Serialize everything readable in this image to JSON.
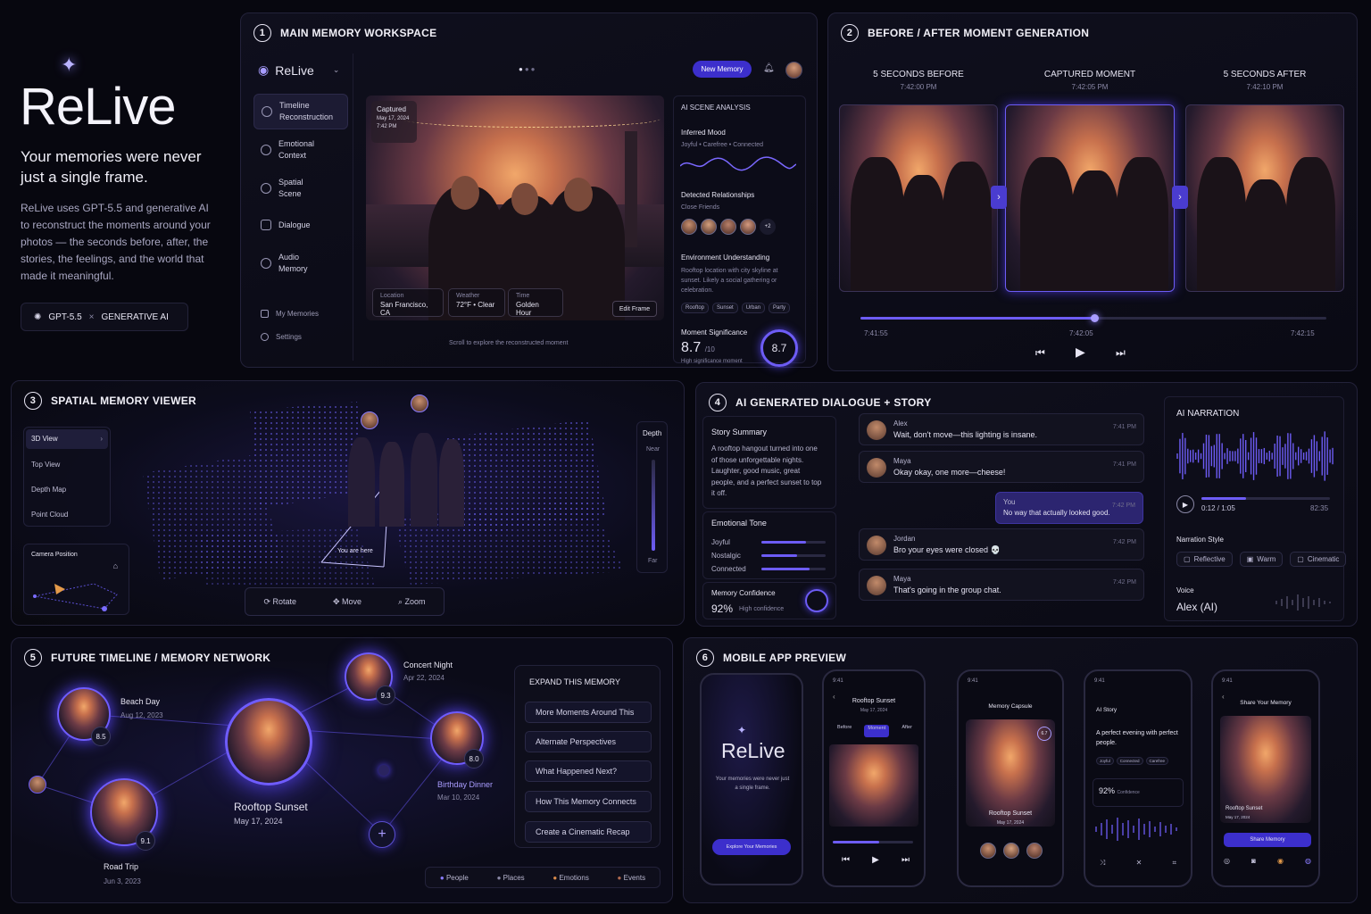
{
  "hero": {
    "title": "ReLive",
    "tagline": "Your memories were never just a single frame.",
    "description": "ReLive uses GPT-5.5 and generative AI to reconstruct the moments around your photos — the seconds before, after, the stories, the feelings, and the world that made it meaningful.",
    "badge_model": "GPT-5.5",
    "badge_sep": "×",
    "badge_ai": "GENERATIVE AI"
  },
  "p1": {
    "num": "1",
    "title": "MAIN MEMORY WORKSPACE",
    "app": "ReLive",
    "new_memory": "New Memory",
    "nav": [
      "Timeline Reconstruction",
      "Emotional Context",
      "Spatial Scene",
      "Dialogue",
      "Audio Memory"
    ],
    "nav_bottom": [
      "My Memories",
      "Settings"
    ],
    "captured": "Captured",
    "captured_date": "May 17, 2024",
    "captured_time": "7:42 PM",
    "loc_l": "Location",
    "loc_v": "San Francisco, CA",
    "weather_l": "Weather",
    "weather_v": "72°F • Clear",
    "time_l": "Time",
    "time_v": "Golden Hour",
    "edit": "Edit Frame",
    "scroll": "Scroll to explore the reconstructed moment",
    "analysis": "AI SCENE ANALYSIS",
    "mood_h": "Inferred Mood",
    "mood_v": "Joyful • Carefree • Connected",
    "rel_h": "Detected Relationships",
    "rel_v": "Close Friends",
    "rel_more": "+2",
    "env_h": "Environment Understanding",
    "env_v": "Rooftop location with city skyline at sunset. Likely a social gathering or celebration.",
    "tags": [
      "Rooftop",
      "Sunset",
      "Urban",
      "Party"
    ],
    "sig_h": "Moment Significance",
    "sig_v": "8.7",
    "sig_of": "/10",
    "sig_note": "High significance moment",
    "ring": "8.7"
  },
  "p2": {
    "num": "2",
    "title": "BEFORE / AFTER MOMENT GENERATION",
    "cols": [
      {
        "label": "5 SECONDS BEFORE",
        "time": "7:42:00 PM"
      },
      {
        "label": "CAPTURED MOMENT",
        "time": "7:42:05 PM"
      },
      {
        "label": "5 SECONDS AFTER",
        "time": "7:42:10 PM"
      }
    ],
    "t_start": "7:41:55",
    "t_mid": "7:42:05",
    "t_end": "7:42:15"
  },
  "p3": {
    "num": "3",
    "title": "SPATIAL MEMORY VIEWER",
    "views": [
      "3D View",
      "Top View",
      "Depth Map",
      "Point Cloud"
    ],
    "camera": "Camera Position",
    "you": "You are here",
    "depth": "Depth",
    "near": "Near",
    "far": "Far",
    "controls": [
      "Rotate",
      "Move",
      "Zoom"
    ]
  },
  "p4": {
    "num": "4",
    "title": "AI GENERATED DIALOGUE + STORY",
    "story_h": "Story Summary",
    "story": "A rooftop hangout turned into one of those unforgettable nights. Laughter, good music, great people, and a perfect sunset to top it off.",
    "tone_h": "Emotional Tone",
    "tones": [
      {
        "label": "Joyful",
        "level": 0.7
      },
      {
        "label": "Nostalgic",
        "level": 0.55
      },
      {
        "label": "Connected",
        "level": 0.75
      }
    ],
    "conf_h": "Memory Confidence",
    "conf_v": "92%",
    "conf_note": "High confidence",
    "chat": [
      {
        "name": "Alex",
        "text": "Wait, don't move—this lighting is insane.",
        "time": "7:41 PM"
      },
      {
        "name": "Maya",
        "text": "Okay okay, one more—cheese!",
        "time": "7:41 PM"
      },
      {
        "name": "You",
        "text": "No way that actually looked good.",
        "time": "7:42 PM"
      },
      {
        "name": "Jordan",
        "text": "Bro your eyes were closed 💀",
        "time": "7:42 PM"
      },
      {
        "name": "Maya",
        "text": "That's going in the group chat.",
        "time": "7:42 PM"
      }
    ],
    "narr_h": "AI NARRATION",
    "narr_pos": "0:12 / 1:05",
    "narr_end": "82:35",
    "style_h": "Narration Style",
    "styles": [
      "Reflective",
      "Warm",
      "Cinematic"
    ],
    "voice_h": "Voice",
    "voice_v": "Alex (AI)"
  },
  "p5": {
    "num": "5",
    "title": "FUTURE TIMELINE / MEMORY NETWORK",
    "nodes": [
      {
        "name": "Beach Day",
        "date": "Aug 12, 2023",
        "score": "8.5"
      },
      {
        "name": "Concert Night",
        "date": "Apr 22, 2024",
        "score": "9.3"
      },
      {
        "name": "Rooftop Sunset",
        "date": "May 17, 2024"
      },
      {
        "name": "Birthday Dinner",
        "date": "Mar 10, 2024",
        "score": "8.0"
      },
      {
        "name": "Road Trip",
        "date": "Jun 3, 2023",
        "score": "9.1"
      }
    ],
    "expand_h": "EXPAND THIS MEMORY",
    "expand": [
      "More Moments Around This",
      "Alternate Perspectives",
      "What Happened Next?",
      "How This Memory Connects",
      "Create a Cinematic Recap"
    ],
    "legend": [
      "People",
      "Places",
      "Emotions",
      "Events"
    ]
  },
  "p6": {
    "num": "6",
    "title": "MOBILE APP PREVIEW",
    "brand": "ReLive",
    "tagline": "Your memories were never just a single frame.",
    "explore": "Explore Your Memories",
    "ph2_title": "Rooftop Sunset",
    "ph2_date": "May 17, 2024",
    "ph2_tabs": [
      "Before",
      "Moment",
      "After"
    ],
    "time": "9:41",
    "ph3_title": "Memory Capsule",
    "ph3_score": "6.7",
    "ph3_name": "Rooftop Sunset",
    "ph3_date": "May 17, 2024",
    "ph4_title": "AI Story",
    "ph4_text": "A perfect evening with perfect people.",
    "ph4_tags": [
      "Joyful",
      "Connected",
      "Carefree"
    ],
    "ph4_conf": "92%",
    "ph4_conf_l": "Confidence",
    "ph5_title": "Share Your Memory",
    "ph5_name": "Rooftop Sunset",
    "ph5_date": "May 17, 2024",
    "ph5_btn": "Share Memory"
  },
  "colors": {
    "accent": "#6d5cf5",
    "bg": "#07070f"
  }
}
